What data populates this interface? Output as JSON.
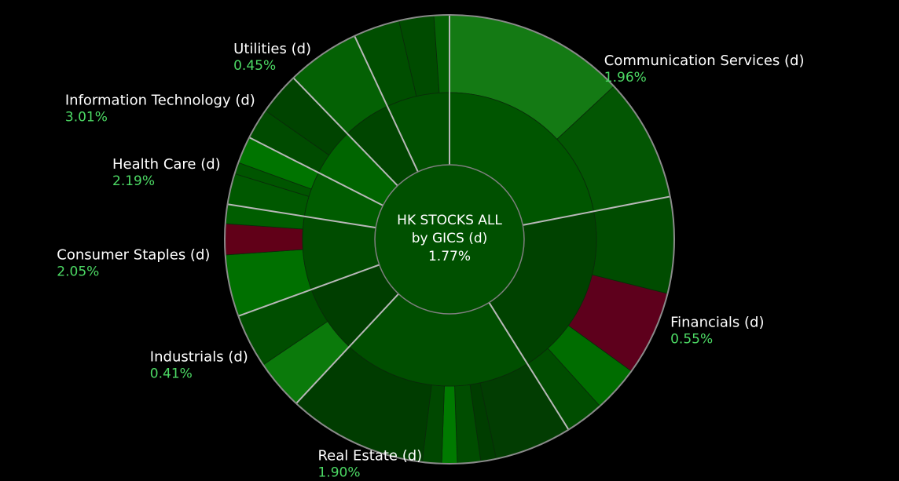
{
  "chart_data": {
    "type": "sunburst",
    "center": {
      "lines": [
        "HK STOCKS ALL",
        "by GICS (d)",
        "1.77%"
      ]
    },
    "outer_colors": [
      "#147a14",
      "#035603",
      "#004c00",
      "#5e001c",
      "#006d00",
      "#004d00",
      "#003d00",
      "#023d02",
      "#007a00",
      "#004800",
      "#003c00",
      "#0b7a0b",
      "#004e00",
      "#007000",
      "#610018",
      "#005d00",
      "#005800",
      "#005500",
      "#007400",
      "#004b00",
      "#004400",
      "#046104"
    ],
    "sectors": [
      {
        "name": "Communication Services (d)",
        "value": "1.96%",
        "start": 0,
        "end": 79,
        "color": "#005500",
        "outer": [
          {
            "start": 0,
            "end": 47,
            "color": 0
          },
          {
            "start": 47,
            "end": 79,
            "color": 1
          }
        ]
      },
      {
        "name": "Financials (d)",
        "value": "0.55%",
        "start": 79,
        "end": 148,
        "color": "#004200",
        "outer": [
          {
            "start": 79,
            "end": 104,
            "color": 2
          },
          {
            "start": 104,
            "end": 126,
            "color": 3
          },
          {
            "start": 126,
            "end": 138,
            "color": 4
          },
          {
            "start": 138,
            "end": 148,
            "color": 5
          }
        ]
      },
      {
        "name": "Real Estate (d)",
        "value": "1.90%",
        "start": 148,
        "end": 223,
        "color": "#004f00",
        "outer": [
          {
            "start": 148,
            "end": 168,
            "color": 7
          },
          {
            "start": 168,
            "end": 172,
            "color": 6
          },
          {
            "start": 172,
            "end": 178,
            "color": 5
          },
          {
            "start": 178,
            "end": 182,
            "color": 8
          },
          {
            "start": 182,
            "end": 187,
            "color": 9
          },
          {
            "start": 187,
            "end": 223,
            "color": 10
          }
        ]
      },
      {
        "name": "Industrials (d)",
        "value": "0.41%",
        "start": 223,
        "end": 250,
        "color": "#003e00",
        "outer": [
          {
            "start": 223,
            "end": 236,
            "color": 11
          },
          {
            "start": 236,
            "end": 250,
            "color": 12
          }
        ]
      },
      {
        "name": "Consumer Staples (d)",
        "value": "2.05%",
        "start": 250,
        "end": 279,
        "color": "#004c00",
        "outer": [
          {
            "start": 250,
            "end": 266,
            "color": 13
          },
          {
            "start": 266,
            "end": 274,
            "color": 14
          },
          {
            "start": 274,
            "end": 279,
            "color": 15
          }
        ]
      },
      {
        "name": "Health Care (d)",
        "value": "2.19%",
        "start": 279,
        "end": 297,
        "color": "#005c00",
        "outer": [
          {
            "start": 279,
            "end": 287,
            "color": 16
          },
          {
            "start": 287,
            "end": 290,
            "color": 17
          },
          {
            "start": 290,
            "end": 297,
            "color": 18
          }
        ]
      },
      {
        "name": "Information Technology (d)",
        "value": "3.01%",
        "start": 297,
        "end": 316,
        "color": "#006500",
        "outer": [
          {
            "start": 297,
            "end": 305,
            "color": 19
          },
          {
            "start": 305,
            "end": 316,
            "color": 20
          }
        ]
      },
      {
        "name": "Utilities (d)",
        "value": "0.45%",
        "start": 316,
        "end": 335,
        "color": "#004500",
        "outer": [
          {
            "start": 316,
            "end": 335,
            "color": 21
          }
        ]
      },
      {
        "name": "",
        "value": "",
        "start": 335,
        "end": 360,
        "color": "#005000",
        "outer": [
          {
            "start": 335,
            "end": 347,
            "color": 12
          },
          {
            "start": 347,
            "end": 356,
            "color": 19
          },
          {
            "start": 356,
            "end": 360,
            "color": 21
          }
        ]
      }
    ]
  }
}
